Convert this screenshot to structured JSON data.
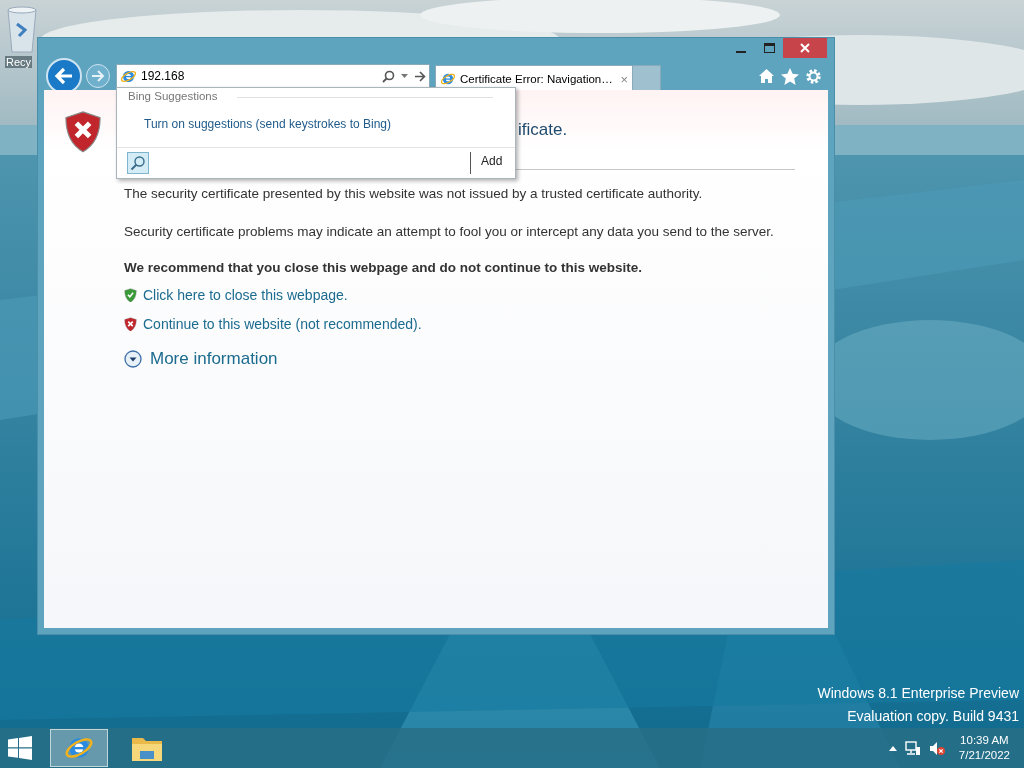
{
  "desktop": {
    "icons": [
      {
        "label": "Recy"
      }
    ],
    "watermark": [
      "Windows 8.1 Enterprise Preview",
      "Evaluation copy. Build 9431"
    ]
  },
  "browser": {
    "address": "192.168",
    "tabs": [
      {
        "title": "Certificate Error: Navigation…",
        "close": "×",
        "selected": true
      }
    ],
    "suggestions": {
      "header": "Bing Suggestions",
      "items": [
        "Turn on suggestions (send keystrokes to Bing)"
      ],
      "add": "Add"
    },
    "page": {
      "heading": "ificate.",
      "paragraphs": [
        "The security certificate presented by this website was not issued by a trusted certificate authority.",
        "Security certificate problems may indicate an attempt to fool you or intercept any data you send to the server."
      ],
      "recommendation": "We recommend that you close this webpage and do not continue to this website.",
      "links": [
        {
          "kind": "safe",
          "text": "Click here to close this webpage."
        },
        {
          "kind": "unsafe",
          "text": "Continue to this website (not recommended)."
        }
      ],
      "more_info": "More information"
    }
  },
  "taskbar": {
    "apps": [
      {
        "kind": "browser",
        "selected": true
      },
      {
        "kind": "files",
        "selected": false
      }
    ],
    "time": "10:39 AM",
    "date": "7/21/2022"
  }
}
